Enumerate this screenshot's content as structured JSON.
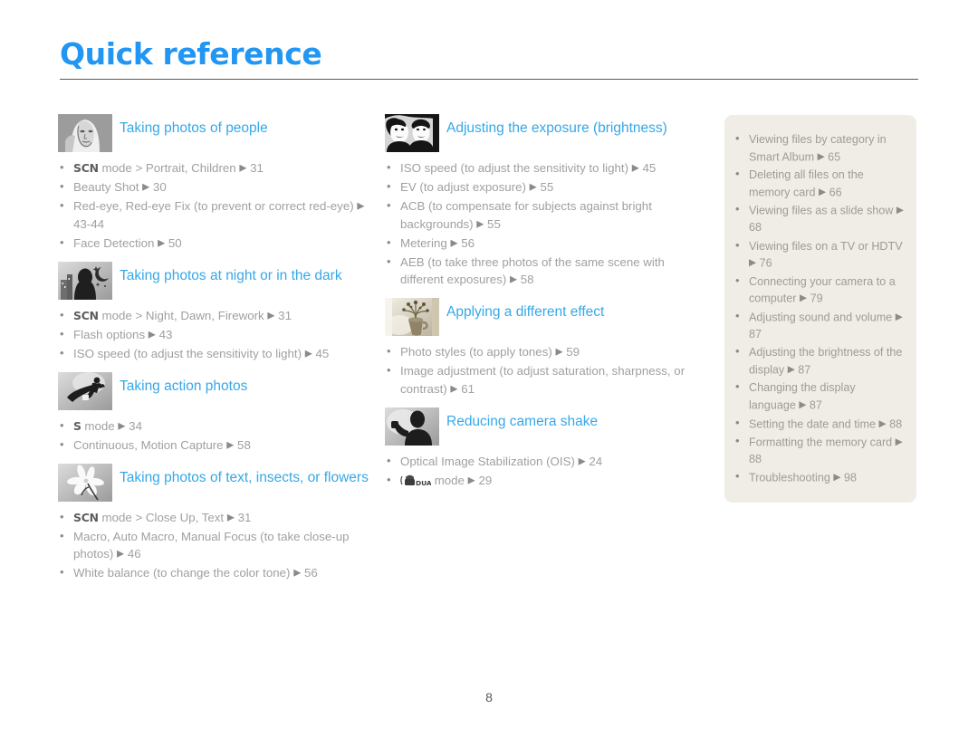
{
  "header": {
    "title": "Quick reference",
    "accent_color": "#2196f3",
    "rule_color": "#5a5a5a"
  },
  "footer": {
    "page_number": "8"
  },
  "theme": {
    "section_title_color": "#35a8e8",
    "body_text_color": "#a0a0a0",
    "panel_bg": "#efede6",
    "panel_text_color": "#9e9c94"
  },
  "columns": {
    "left": [
      {
        "icon": "portrait-face-thumbnail",
        "title": "Taking photos of people",
        "items": [
          {
            "mode": "SCN",
            "text": " mode > Portrait, Children ",
            "page": "31"
          },
          {
            "mode": "",
            "text": "Beauty Shot ",
            "page": "30"
          },
          {
            "mode": "",
            "text": "Red-eye, Red-eye Fix (to prevent or correct red-eye) ",
            "page": "43-44"
          },
          {
            "mode": "",
            "text": "Face Detection ",
            "page": "50"
          }
        ]
      },
      {
        "icon": "night-scene-thumbnail",
        "title": "Taking photos at night or in the dark",
        "items": [
          {
            "mode": "SCN",
            "text": " mode > Night, Dawn, Firework ",
            "page": "31"
          },
          {
            "mode": "",
            "text": "Flash options ",
            "page": "43"
          },
          {
            "mode": "",
            "text": "ISO speed (to adjust the sensitivity to light) ",
            "page": "45"
          }
        ]
      },
      {
        "icon": "snowboarder-action-thumbnail",
        "title": "Taking action photos",
        "items": [
          {
            "mode": "S",
            "text": " mode ",
            "page": "34"
          },
          {
            "mode": "",
            "text": "Continuous, Motion Capture ",
            "page": "58"
          }
        ]
      },
      {
        "icon": "flower-macro-thumbnail",
        "title": "Taking photos of text, insects, or flowers",
        "items": [
          {
            "mode": "SCN",
            "text": " mode > Close Up, Text ",
            "page": "31"
          },
          {
            "mode": "",
            "text": "Macro, Auto Macro, Manual Focus (to take close-up photos) ",
            "page": "46"
          },
          {
            "mode": "",
            "text": "White balance (to change the color tone) ",
            "page": "56"
          }
        ]
      }
    ],
    "middle": [
      {
        "icon": "two-faces-exposure-thumbnail",
        "title": "Adjusting the exposure (brightness)",
        "items": [
          {
            "mode": "",
            "text": "ISO speed (to adjust the sensitivity to light) ",
            "page": "45"
          },
          {
            "mode": "",
            "text": "EV (to adjust exposure) ",
            "page": "55"
          },
          {
            "mode": "",
            "text": "ACB (to compensate for subjects against bright backgrounds) ",
            "page": "55"
          },
          {
            "mode": "",
            "text": "Metering ",
            "page": "56"
          },
          {
            "mode": "",
            "text": "AEB (to take three photos of the same scene with different exposures) ",
            "page": "58"
          }
        ]
      },
      {
        "icon": "vase-flowers-effect-thumbnail",
        "title": "Applying a different effect",
        "items": [
          {
            "mode": "",
            "text": "Photo styles (to apply tones) ",
            "page": "59"
          },
          {
            "mode": "",
            "text": "Image adjustment (to adjust saturation, sharpness, or contrast) ",
            "page": "61"
          }
        ]
      },
      {
        "icon": "person-camera-shake-thumbnail",
        "title": "Reducing camera shake",
        "items": [
          {
            "mode": "",
            "text": "Optical Image Stabilization (OIS) ",
            "page": "24"
          },
          {
            "mode": "DUAL-IS-ICON",
            "text": " mode ",
            "page": "29"
          }
        ]
      }
    ],
    "right_panel": [
      {
        "text": "Viewing files by category in Smart Album ",
        "page": "65"
      },
      {
        "text": "Deleting all files on the memory card ",
        "page": "66"
      },
      {
        "text": "Viewing files as a slide show ",
        "page": "68"
      },
      {
        "text": "Viewing files on a TV or HDTV ",
        "page": "76"
      },
      {
        "text": "Connecting your camera to a computer ",
        "page": "79"
      },
      {
        "text": "Adjusting sound and volume ",
        "page": "87"
      },
      {
        "text": "Adjusting the brightness of the display ",
        "page": "87"
      },
      {
        "text": "Changing the display language ",
        "page": "87"
      },
      {
        "text": "Setting the date and time ",
        "page": "88"
      },
      {
        "text": "Formatting the memory card ",
        "page": "88"
      },
      {
        "text": "Troubleshooting ",
        "page": "98"
      }
    ]
  }
}
